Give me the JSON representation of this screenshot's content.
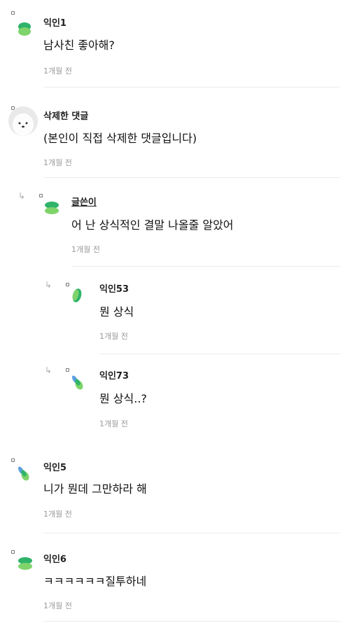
{
  "comments": [
    {
      "name": "익인1",
      "text": "남사친 좋아해?",
      "time": "1개월 전"
    },
    {
      "name": "삭제한 댓글",
      "text": "(본인이 직접 삭제한 댓글입니다)",
      "time": "1개월 전"
    },
    {
      "name": "글쓴이",
      "text": "어 난 상식적인 결말 나올줄 알았어",
      "time": "1개월 전"
    },
    {
      "name": "익인53",
      "text": "뭔 상식",
      "time": "1개월 전"
    },
    {
      "name": "익인73",
      "text": "뭔 상식..?",
      "time": "1개월 전"
    },
    {
      "name": "익인5",
      "text": "니가 뭔데 그만하라 해",
      "time": "1개월 전"
    },
    {
      "name": "익인6",
      "text": "ㅋㅋㅋㅋㅋㅋ질투하네",
      "time": "1개월 전"
    }
  ],
  "icons": {
    "reply_arrow": "reply-arrow-icon",
    "avatar_colors": [
      "#2fb36a",
      "#7fd36b",
      "#5aa0e0"
    ]
  }
}
